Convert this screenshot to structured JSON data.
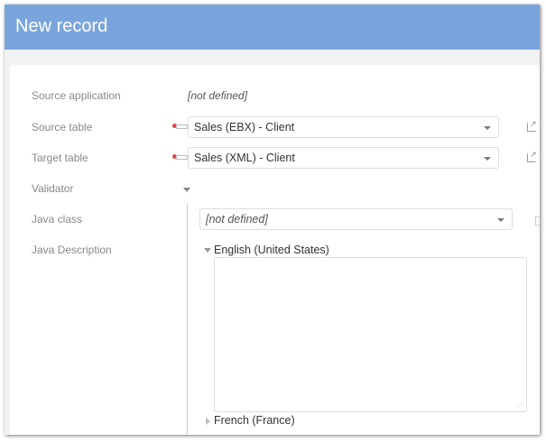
{
  "header": {
    "title": "New record"
  },
  "fields": {
    "source_application": {
      "label": "Source application",
      "value": "[not defined]"
    },
    "source_table": {
      "label": "Source table",
      "value": "Sales (EBX) - Client"
    },
    "target_table": {
      "label": "Target table",
      "value": "Sales (XML) - Client"
    },
    "validator": {
      "label": "Validator"
    },
    "java_class": {
      "label": "Java class",
      "value": "[not defined]"
    },
    "java_description": {
      "label": "Java Description",
      "languages": [
        "English (United States)",
        "French (France)"
      ],
      "value": ""
    }
  },
  "colors": {
    "header": "#7aa5dc",
    "required_key": "#e04848"
  }
}
